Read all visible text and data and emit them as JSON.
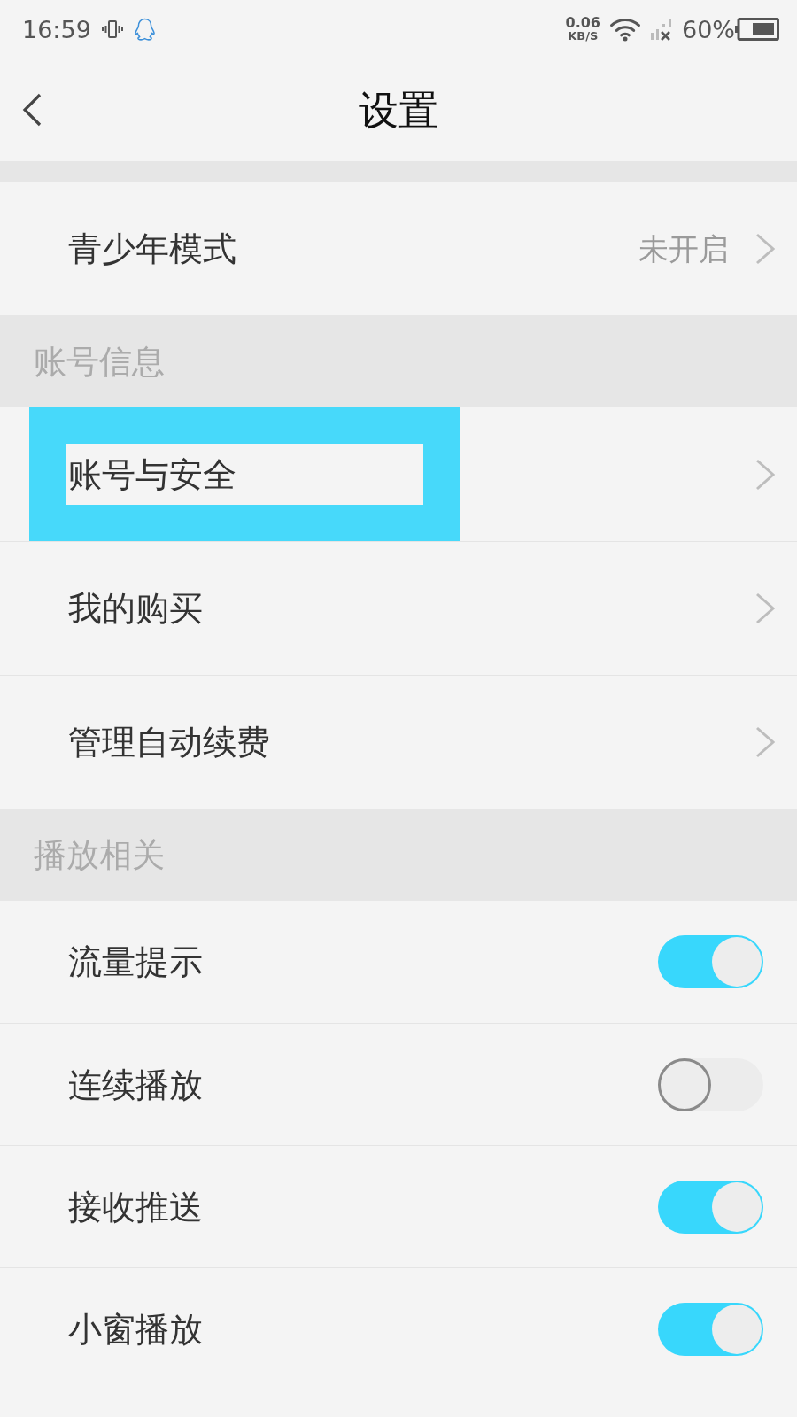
{
  "status_bar": {
    "time": "16:59",
    "speed_value": "0.06",
    "speed_unit": "KB/S",
    "battery_percent": "60%"
  },
  "header": {
    "title": "设置"
  },
  "sections": [
    {
      "rows": [
        {
          "kind": "link",
          "label": "青少年模式",
          "value": "未开启",
          "highlighted": false
        }
      ]
    },
    {
      "title": "账号信息",
      "rows": [
        {
          "kind": "link",
          "label": "账号与安全",
          "highlighted": true
        },
        {
          "kind": "link",
          "label": "我的购买",
          "highlighted": false
        },
        {
          "kind": "link",
          "label": "管理自动续费",
          "highlighted": false
        }
      ]
    },
    {
      "title": "播放相关",
      "rows": [
        {
          "kind": "toggle",
          "label": "流量提示",
          "on": true,
          "highlighted": false
        },
        {
          "kind": "toggle",
          "label": "连续播放",
          "on": false,
          "highlighted": false
        },
        {
          "kind": "toggle",
          "label": "接收推送",
          "on": true,
          "highlighted": false
        },
        {
          "kind": "toggle",
          "label": "小窗播放",
          "on": true,
          "highlighted": false
        }
      ]
    }
  ]
}
